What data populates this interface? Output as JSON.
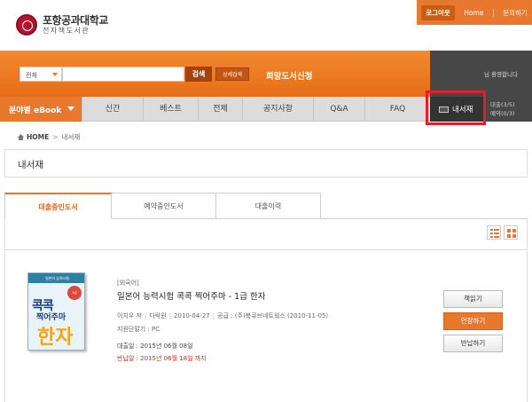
{
  "header": {
    "logo_main": "포항공과대학교",
    "logo_sub": "전자책도서관",
    "util": [
      "로그아웃",
      "Home",
      "문의하기"
    ]
  },
  "search": {
    "scope": "전체",
    "button": "검색",
    "advanced": "상세검색",
    "wish": "희망도서신청"
  },
  "welcome": "님 환영합니다",
  "nav": {
    "genre": "분야별 eBook",
    "items": [
      "신간",
      "베스트",
      "전체",
      "공지사항",
      "Q&A",
      "FAQ"
    ],
    "shelf": "내서재",
    "loan_status": "대출(3/5)",
    "reserve_status": "예약(0/3)"
  },
  "breadcrumb": {
    "home": "HOME",
    "current": "내서재"
  },
  "page_title": "내서재",
  "tabs": [
    "대출중인도서",
    "예약중인도서",
    "대출이력"
  ],
  "book": {
    "category": "[외국어]",
    "title": "일본어 능력시험 콕콕 찍어주마 - 1급 한자",
    "author": "이치우 저",
    "publisher": "다락원",
    "pub_date": "2010-04-27",
    "supplier": "공급 : (주)북큐브네트웍스 (2010-11-05)",
    "device": "지원단말기 : PC",
    "loan_date": "대출일 : 2015년 06월 08일",
    "due_date": "반납일 : 2015년 06월 18일 까지",
    "cover": {
      "band": "일본어 능력시험",
      "t1": "콕콕",
      "t2": "찍어주마",
      "t3": "한자",
      "badge": "1급"
    },
    "actions": [
      "책읽기",
      "연장하기",
      "반납하기"
    ]
  },
  "colors": {
    "accent": "#e8782d",
    "dark": "#474747",
    "highlight": "#e01f2b"
  }
}
